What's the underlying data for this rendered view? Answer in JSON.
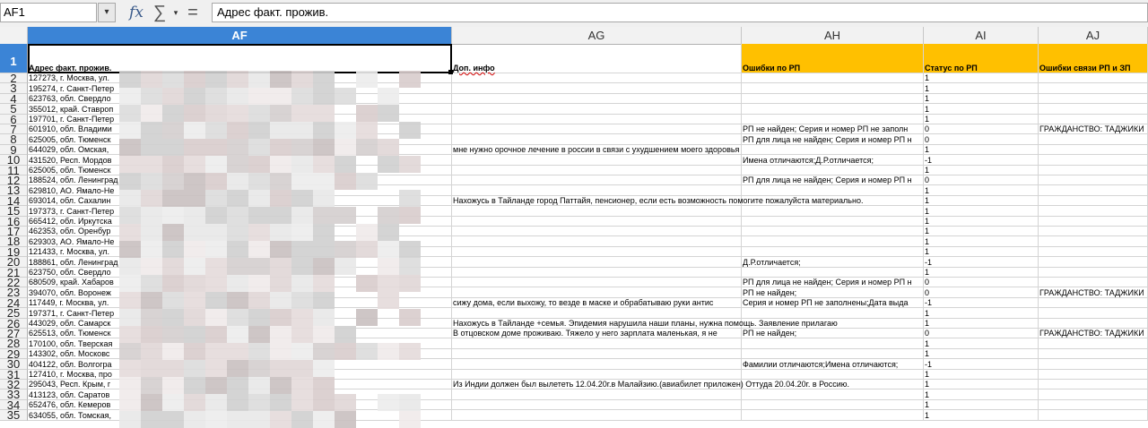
{
  "formula_bar": {
    "name_box": "AF1",
    "formula": "Адрес факт. прожив."
  },
  "icons": {
    "namebox_drop": "chevron-down-icon",
    "function_wizard": "fx-icon",
    "sum": "sum-icon",
    "sum_drop": "dropdown-icon",
    "formula": "equals-icon"
  },
  "columns": [
    {
      "label": "AF",
      "selected": true
    },
    {
      "label": "AG",
      "selected": false
    },
    {
      "label": "AH",
      "selected": false
    },
    {
      "label": "AI",
      "selected": false
    },
    {
      "label": "AJ",
      "selected": false
    }
  ],
  "colors": {
    "selection": "#3b84d6",
    "header_fill": "#ffc000",
    "spell_underline": "#d00000"
  },
  "header_row": {
    "number": "1",
    "af": "Адрес факт. прожив.",
    "ag": "Доп. инфо",
    "ah": "Ошибки по РП",
    "ai": "Статус по РП",
    "aj": "Ошибки связи РП и ЗП"
  },
  "rows": [
    {
      "n": "2",
      "af": "127273, г. Москва, ул.",
      "ag": "",
      "ah": "",
      "ai": "1",
      "aj": ""
    },
    {
      "n": "3",
      "af": "195274, г. Санкт-Петер",
      "ag": "",
      "ah": "",
      "ai": "1",
      "aj": ""
    },
    {
      "n": "4",
      "af": "623763, обл. Свердло",
      "ag": "",
      "ah": "",
      "ai": "1",
      "aj": ""
    },
    {
      "n": "5",
      "af": "355012, край. Ставроп",
      "ag": "",
      "ah": "",
      "ai": "1",
      "aj": ""
    },
    {
      "n": "6",
      "af": "197701, г. Санкт-Петер",
      "ag": "",
      "ah": "",
      "ai": "1",
      "aj": ""
    },
    {
      "n": "7",
      "af": "601910, обл. Владими",
      "ag": "",
      "ah": "РП не найден; Серия и номер РП не заполн",
      "ai": "0",
      "aj": "ГРАЖДАНСТВО: ТАДЖИКИ"
    },
    {
      "n": "8",
      "af": "625005, обл. Тюменск",
      "ag": "",
      "ah": "РП для лица не найден; Серия и номер РП н",
      "ai": "0",
      "aj": ""
    },
    {
      "n": "9",
      "af": "644029, обл. Омская,",
      "ag": "мне нужно орочное лечение в россии в связи с ухудшением моего здоровья",
      "ah": "",
      "ai": "1",
      "aj": ""
    },
    {
      "n": "10",
      "af": "431520, Респ. Мордов",
      "ag": "",
      "ah": "Имена отличаются;Д.Р.отличается;",
      "ai": "-1",
      "aj": ""
    },
    {
      "n": "11",
      "af": "625005, обл. Тюменск",
      "ag": "",
      "ah": "",
      "ai": "1",
      "aj": ""
    },
    {
      "n": "12",
      "af": "188524, обл. Ленинград",
      "ag": "",
      "ah": "РП для лица не найден; Серия и номер РП н",
      "ai": "0",
      "aj": ""
    },
    {
      "n": "13",
      "af": "629810, АО. Ямало-Не",
      "ag": "",
      "ah": "",
      "ai": "1",
      "aj": ""
    },
    {
      "n": "14",
      "af": "693014, обл. Сахалин",
      "ag": "Нахожусь в Тайланде город Паттайя, пенсионер, если есть возможность помогите пожалуйста материально.",
      "ah": "",
      "ai": "1",
      "aj": ""
    },
    {
      "n": "15",
      "af": "197373, г. Санкт-Петер",
      "ag": "",
      "ah": "",
      "ai": "1",
      "aj": ""
    },
    {
      "n": "16",
      "af": "665412, обл. Иркутска",
      "ag": "",
      "ah": "",
      "ai": "1",
      "aj": ""
    },
    {
      "n": "17",
      "af": "462353, обл. Оренбур",
      "ag": "",
      "ah": "",
      "ai": "1",
      "aj": ""
    },
    {
      "n": "18",
      "af": "629303, АО. Ямало-Не",
      "ag": "",
      "ah": "",
      "ai": "1",
      "aj": ""
    },
    {
      "n": "19",
      "af": "121433, г. Москва, ул.",
      "ag": "",
      "ah": "",
      "ai": "1",
      "aj": ""
    },
    {
      "n": "20",
      "af": "188861, обл. Ленинград",
      "ag": "",
      "ah": "Д.Р.отличается;",
      "ai": "-1",
      "aj": ""
    },
    {
      "n": "21",
      "af": "623750, обл. Свердло",
      "ag": "",
      "ah": "",
      "ai": "1",
      "aj": ""
    },
    {
      "n": "22",
      "af": "680509, край. Хабаров",
      "ag": "",
      "ah": "РП для лица не найден; Серия и номер РП н",
      "ai": "0",
      "aj": ""
    },
    {
      "n": "23",
      "af": "394070, обл. Воронеж",
      "ag": "",
      "ah": "РП не найден;",
      "ai": "0",
      "aj": "ГРАЖДАНСТВО: ТАДЖИКИ"
    },
    {
      "n": "24",
      "af": "117449, г. Москва, ул.",
      "ag": "сижу дома, если выхожу, то везде в маске и обрабатываю руки антис",
      "ah": "Серия и номер РП не заполнены;Дата выда",
      "ai": "-1",
      "aj": ""
    },
    {
      "n": "25",
      "af": "197371, г. Санкт-Петер",
      "ag": "",
      "ah": "",
      "ai": "1",
      "aj": ""
    },
    {
      "n": "26",
      "af": "443029, обл. Самарск",
      "ag": "Нахожусь в Тайланде +семья. Эпидемия нарушила наши планы, нужна помощь. Заявление прилагаю",
      "ah": "",
      "ai": "1",
      "aj": ""
    },
    {
      "n": "27",
      "af": "625513, обл. Тюменск",
      "ag": "В отцовском доме проживаю. Тяжело у него зарплата маленькая, я не",
      "ah": "РП не найден;",
      "ai": "0",
      "aj": "ГРАЖДАНСТВО: ТАДЖИКИ"
    },
    {
      "n": "28",
      "af": "170100, обл. Тверская",
      "ag": "",
      "ah": "",
      "ai": "1",
      "aj": ""
    },
    {
      "n": "29",
      "af": "143302, обл. Московс",
      "ag": "",
      "ah": "",
      "ai": "1",
      "aj": ""
    },
    {
      "n": "30",
      "af": "404122, обл. Волгогра",
      "ag": "",
      "ah": "Фамилии отличаются;Имена отличаются;",
      "ai": "-1",
      "aj": ""
    },
    {
      "n": "31",
      "af": "127410, г. Москва, про",
      "ag": "",
      "ah": "",
      "ai": "1",
      "aj": ""
    },
    {
      "n": "32",
      "af": "295043, Респ. Крым, г",
      "ag": "Из Индии должен был вылететь 12.04.20г.в Малайзию.(авиабилет приложен) Оттуда 20.04.20г. в Россию.",
      "ah": "",
      "ai": "1",
      "aj": ""
    },
    {
      "n": "33",
      "af": "413123, обл. Саратов",
      "ag": "",
      "ah": "",
      "ai": "1",
      "aj": ""
    },
    {
      "n": "34",
      "af": "652476, обл. Кемеров",
      "ag": "",
      "ah": "",
      "ai": "1",
      "aj": ""
    },
    {
      "n": "35",
      "af": "634055, обл. Томская,",
      "ag": "",
      "ah": "",
      "ai": "1",
      "aj": ""
    }
  ]
}
